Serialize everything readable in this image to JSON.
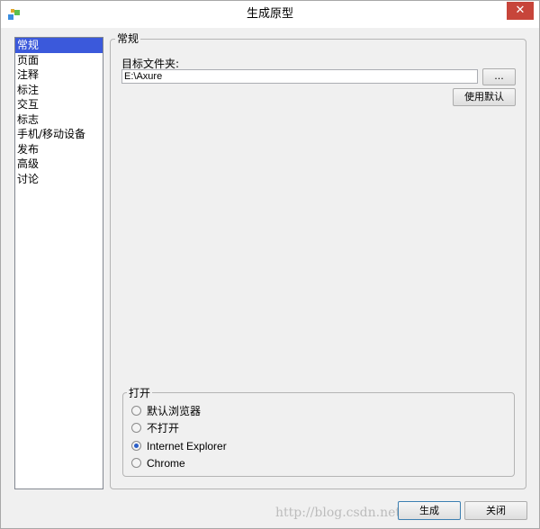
{
  "window": {
    "title": "生成原型",
    "close_glyph": "✕",
    "icon": "axure-app-icon"
  },
  "nav": {
    "items": [
      "常规",
      "页面",
      "注释",
      "标注",
      "交互",
      "标志",
      "手机/移动设备",
      "发布",
      "高级",
      "讨论"
    ],
    "selected": 0
  },
  "general": {
    "legend": "常规",
    "target_folder_label": "目标文件夹:",
    "target_folder_value": "E:\\Axure",
    "browse_label": "...",
    "use_default_label": "使用默认"
  },
  "open": {
    "legend": "打开",
    "options": [
      "默认浏览器",
      "不打开",
      "Internet Explorer",
      "Chrome"
    ],
    "selected": 2
  },
  "footer": {
    "generate_label": "生成",
    "close_label": "关闭"
  },
  "watermark": "http://blog.csdn.net/..."
}
